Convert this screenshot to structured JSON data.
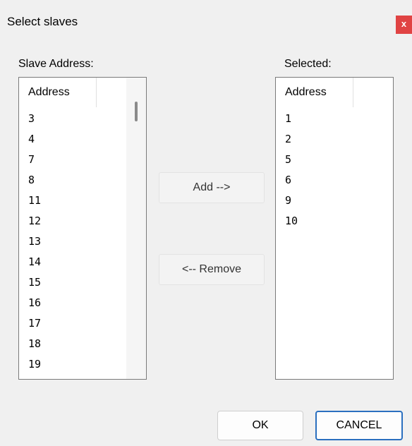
{
  "dialog": {
    "title": "Select slaves",
    "close_label": "x"
  },
  "left_panel": {
    "label": "Slave Address:",
    "column_header": "Address",
    "items": [
      "3",
      "4",
      "7",
      "8",
      "11",
      "12",
      "13",
      "14",
      "15",
      "16",
      "17",
      "18",
      "19"
    ]
  },
  "right_panel": {
    "label": "Selected:",
    "column_header": "Address",
    "items": [
      "1",
      "2",
      "5",
      "6",
      "9",
      "10"
    ]
  },
  "buttons": {
    "add_label": "Add -->",
    "remove_label": "<-- Remove",
    "ok_label": "OK",
    "cancel_label": "CANCEL"
  },
  "colors": {
    "close_button": "#e04343",
    "default_button_border": "#2a6fbf"
  }
}
